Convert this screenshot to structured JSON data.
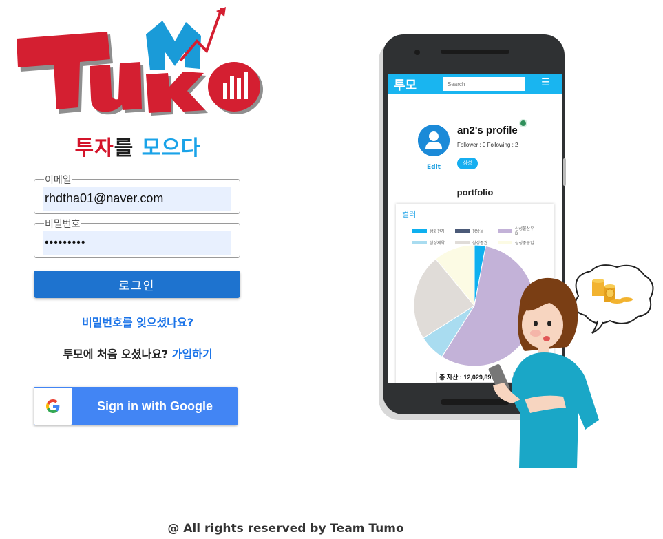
{
  "brand": {
    "logo_text": "TuMo",
    "tagline_part1": "투자",
    "tagline_part2": "를 ",
    "tagline_part3": "모으다"
  },
  "login_form": {
    "email_label": "이메일",
    "email_value": "rhdtha01@naver.com",
    "password_label": "비밀번호",
    "password_value": "•••••••••",
    "login_button": "로그인",
    "forgot_password": "비밀번호를 잊으셨나요?",
    "signup_prompt": "투모에 처음 오셨나요?",
    "signup_link": "가입하기",
    "google_button": "Sign in with Google"
  },
  "footer": {
    "copyright": "@ All rights reserved by Team Tumo"
  },
  "phone_app": {
    "app_title": "투모",
    "search_placeholder": "Search",
    "menu_icon": "hamburger-icon",
    "profile_name": "an2's profile",
    "follow_info": "Follower : 0    Following : 2",
    "edit_label": "Edit",
    "tag_label": "삼성",
    "portfolio_title": "portfolio",
    "chart_title": "컬러",
    "total_asset": "총 자산 : 12,029,89"
  },
  "chart_data": {
    "type": "pie",
    "title": "컬러",
    "series": [
      {
        "name": "삼화전자",
        "value": 3,
        "color": "#0eb0ef"
      },
      {
        "name": "정방울",
        "value": 0,
        "color": "#4b5a78"
      },
      {
        "name": "삼성물산우B",
        "value": 56,
        "color": "#c3b2d8"
      },
      {
        "name": "삼성제약",
        "value": 7,
        "color": "#a9dcf0"
      },
      {
        "name": "삼성증권",
        "value": 23,
        "color": "#e0dcd8"
      },
      {
        "name": "삼성중공업",
        "value": 11,
        "color": "#fcfbe4"
      }
    ]
  },
  "colors": {
    "brand_red": "#d4142a",
    "brand_blue": "#1aa3e8",
    "login_button": "#1e73cf",
    "google_blue": "#4285f4",
    "app_bar": "#19b5f0"
  }
}
